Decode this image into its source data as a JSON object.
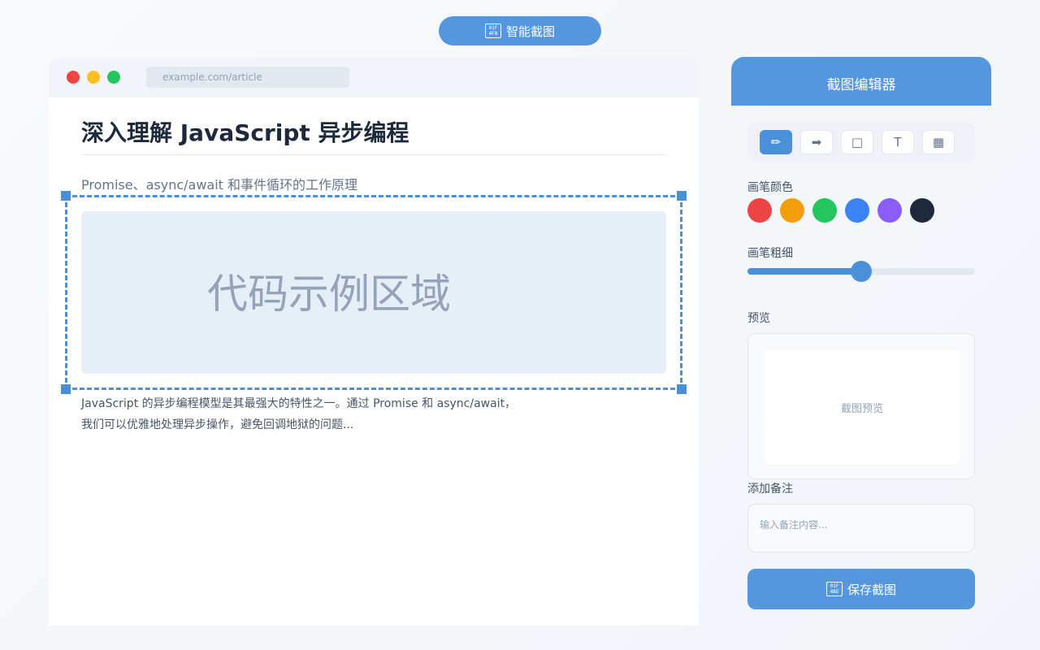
{
  "top_button": {
    "label": "智能截图",
    "icon": "camera-icon"
  },
  "browser": {
    "url": "example.com/article",
    "window_controls": [
      "#ef4444",
      "#fbbf24",
      "#22c55e"
    ]
  },
  "article": {
    "title": "深入理解 JavaScript 异步编程",
    "subtitle": "Promise、async/await 和事件循环的工作原理",
    "code_placeholder": "代码示例区域",
    "body_line1": "JavaScript 的异步编程模型是其最强大的特性之一。通过 Promise 和 async/await，",
    "body_line2": "我们可以优雅地处理异步操作，避免回调地狱的问题..."
  },
  "editor": {
    "title": "截图编辑器",
    "tools": [
      {
        "icon": "pencil-icon",
        "glyph": "✏",
        "active": true
      },
      {
        "icon": "arrow-icon",
        "glyph": "➡",
        "active": false
      },
      {
        "icon": "rectangle-icon",
        "glyph": "□",
        "active": false
      },
      {
        "icon": "text-icon",
        "glyph": "T",
        "active": false
      },
      {
        "icon": "mosaic-icon",
        "glyph": "▦",
        "active": false
      }
    ],
    "color_label": "画笔颜色",
    "colors": [
      "#ef4444",
      "#f59e0b",
      "#22c55e",
      "#3b82f6",
      "#8b5cf6",
      "#1e293b"
    ],
    "thickness_label": "画笔粗细",
    "thickness_fraction": 0.5,
    "preview_label": "预览",
    "preview_placeholder": "截图预览",
    "note_label": "添加备注",
    "note_placeholder": "输入备注内容...",
    "save_label": "保存截图",
    "save_icon": "save-icon"
  }
}
